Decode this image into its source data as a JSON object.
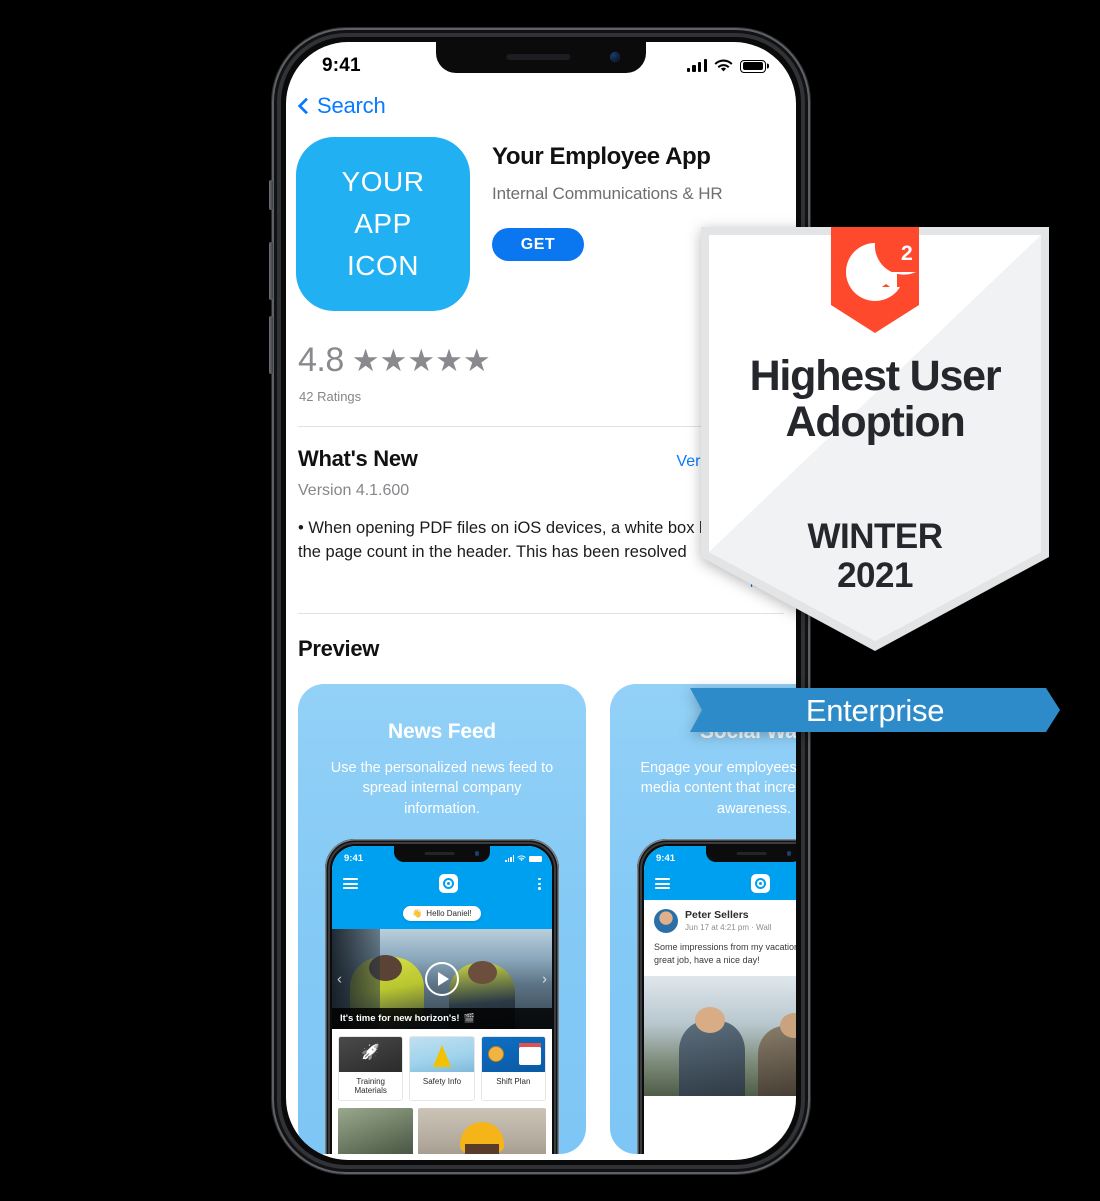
{
  "statusbar": {
    "time": "9:41",
    "signal_icon": "cellular-bars-icon",
    "wifi_icon": "wifi-icon",
    "battery_icon": "battery-icon"
  },
  "nav": {
    "back_label": "Search",
    "back_icon": "chevron-left-icon"
  },
  "app": {
    "icon_line1": "YOUR",
    "icon_line2": "APP",
    "icon_line3": "ICON",
    "icon_color": "#21b0f2",
    "title": "Your Employee App",
    "subtitle": "Internal Communications & HR",
    "get_label": "GET",
    "get_color": "#0a76f0"
  },
  "rating": {
    "value": "4.8",
    "stars": "★★★★★",
    "count_label": "42 Ratings"
  },
  "whats_new": {
    "heading": "What's New",
    "history_link": "Version History",
    "version": "Version 4.1.600",
    "body": "• When opening PDF files on iOS devices, a white box blocked out the page count in the header. This has been resolved",
    "more_link": "more"
  },
  "preview": {
    "heading": "Preview",
    "cards": [
      {
        "title": "News Feed",
        "desc": "Use the personalized news feed to spread internal company information.",
        "mini": {
          "time": "9:41",
          "greeting": "Hello Daniel!",
          "greeting_emoji": "👋",
          "video_caption": "It's time for new horizon's!",
          "video_caption_emoji": "🎬",
          "tiles": [
            "Training Materials",
            "Safety Info",
            "Shift Plan"
          ]
        }
      },
      {
        "title": "Social Wall",
        "desc": "Engage your employees with social media content that increases brand awareness.",
        "mini": {
          "time": "9:41",
          "post_author": "Peter Sellers",
          "post_time": "Jun 17 at 4:21 pm · Wall",
          "post_text": "Some impressions from my vacation, doing a great job, have a nice day!"
        }
      }
    ]
  },
  "g2_badge": {
    "logo": "g2-logo",
    "logo_color": "#ff492c",
    "award_line1": "Highest User",
    "award_line2": "Adoption",
    "segment": "Enterprise",
    "segment_color": "#2e8bc9",
    "season": "WINTER",
    "year": "2021"
  }
}
